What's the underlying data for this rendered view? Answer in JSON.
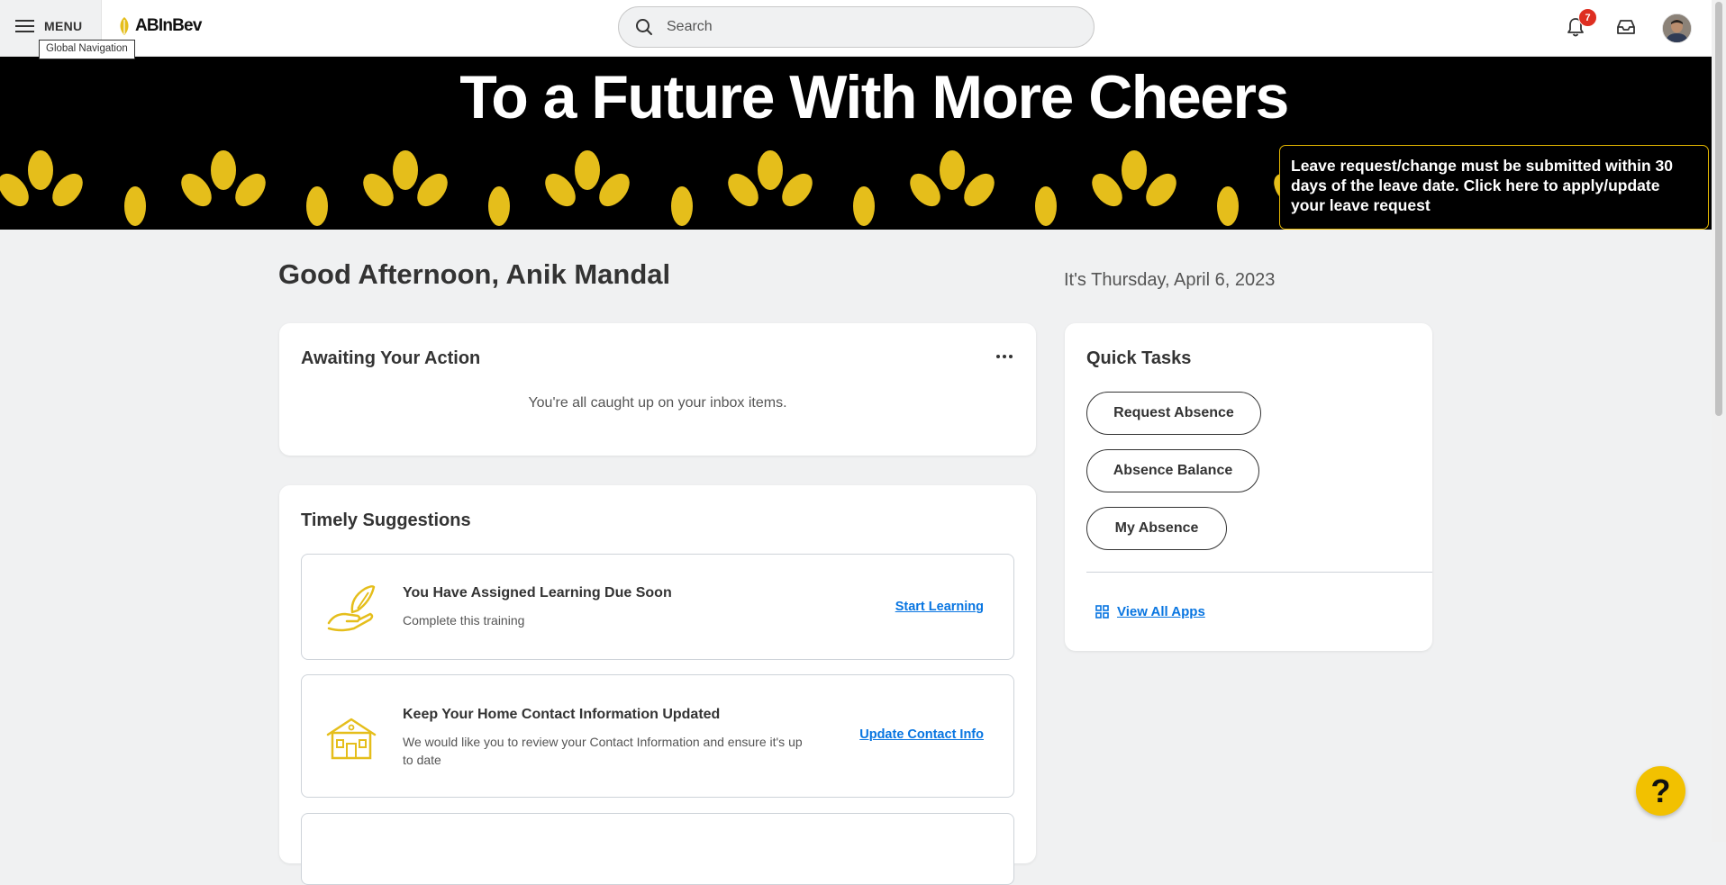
{
  "header": {
    "menu_label": "MENU",
    "menu_tooltip": "Global Navigation",
    "logo_text": "ABInBev",
    "search_placeholder": "Search",
    "notification_count": "7"
  },
  "banner": {
    "title": "To a Future With More Cheers",
    "leave_notice": "Leave request/change must be submitted within 30 days of the leave date. Click here to apply/update your leave request"
  },
  "main": {
    "greeting": "Good Afternoon, Anik Mandal",
    "date": "It's Thursday, April 6, 2023"
  },
  "awaiting": {
    "title": "Awaiting Your Action",
    "empty_message": "You're all caught up on your inbox items."
  },
  "suggestions": {
    "title": "Timely Suggestions",
    "items": [
      {
        "title": "You Have Assigned Learning Due Soon",
        "description": "Complete this training",
        "link": "Start Learning"
      },
      {
        "title": "Keep Your Home Contact Information Updated",
        "description": "We would like you to review your Contact Information and ensure it's up to date",
        "link": "Update Contact Info"
      }
    ]
  },
  "quick_tasks": {
    "title": "Quick Tasks",
    "buttons": [
      "Request Absence",
      "Absence Balance",
      "My Absence"
    ],
    "view_all": "View All Apps"
  },
  "help_label": "?",
  "colors": {
    "accent_yellow": "#e5be1b",
    "link_blue": "#0875e1",
    "badge_red": "#de2e21",
    "banner_black": "#000000",
    "page_bg": "#f0f1f2"
  }
}
